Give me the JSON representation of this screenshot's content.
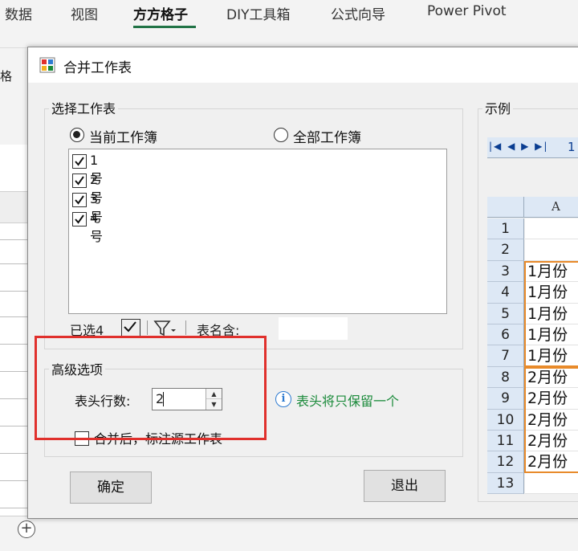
{
  "ribbon": {
    "tabs": [
      {
        "label": "数据"
      },
      {
        "label": "视图"
      },
      {
        "label": "方方格子"
      },
      {
        "label": "DIY工具箱"
      },
      {
        "label": "公式向导"
      },
      {
        "label": "Power Pivot"
      }
    ],
    "active_tab": "方方格子",
    "accent_color": "#217346",
    "partial_label": "格"
  },
  "dialog": {
    "title": "合并工作表",
    "select_group": {
      "legend": "选择工作表",
      "radio_current": "当前工作簿",
      "radio_all": "全部工作簿",
      "selected_radio": "当前工作簿",
      "sheets": [
        {
          "label": "1号",
          "checked": true
        },
        {
          "label": "2号",
          "checked": true
        },
        {
          "label": "3号",
          "checked": true
        },
        {
          "label": "4号",
          "checked": true
        }
      ],
      "selected_count": "已选4",
      "name_contains_label": "表名含:"
    },
    "advanced_group": {
      "legend": "高级选项",
      "header_rows_label": "表头行数:",
      "header_rows_value": "2",
      "info_text": "表头将只保留一个",
      "annotate_source_label": "合并后，标注源工作表",
      "highlight_color": "#e0302c"
    },
    "ok_button": "确定",
    "exit_button": "退出",
    "example": {
      "legend": "示例",
      "sheet_tab": "1",
      "column_header": "A",
      "rows": [
        {
          "num": "1",
          "value": ""
        },
        {
          "num": "2",
          "value": ""
        },
        {
          "num": "3",
          "value": "1月份"
        },
        {
          "num": "4",
          "value": "1月份"
        },
        {
          "num": "5",
          "value": "1月份"
        },
        {
          "num": "6",
          "value": "1月份"
        },
        {
          "num": "7",
          "value": "1月份"
        },
        {
          "num": "8",
          "value": "2月份"
        },
        {
          "num": "9",
          "value": "2月份"
        },
        {
          "num": "10",
          "value": "2月份"
        },
        {
          "num": "11",
          "value": "2月份"
        },
        {
          "num": "12",
          "value": "2月份"
        },
        {
          "num": "13",
          "value": ""
        }
      ],
      "group_box_color": "#e88a2a"
    }
  },
  "bottom": {
    "add_sheet_label": "+"
  }
}
